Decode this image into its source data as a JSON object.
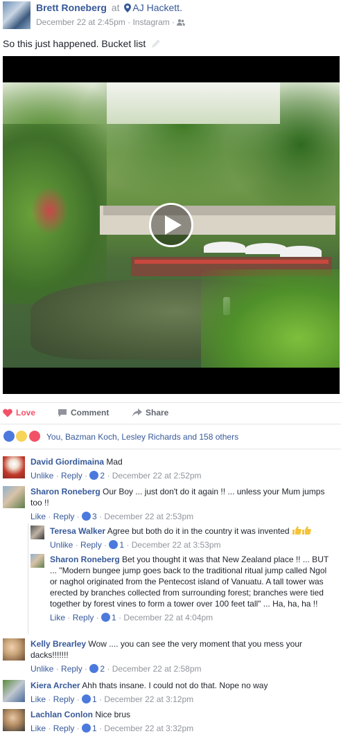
{
  "post": {
    "author": "Brett Roneberg",
    "at_word": "at",
    "place": "AJ Hackett.",
    "date": "December 22 at 2:45pm",
    "separator": "·",
    "source": "Instagram",
    "text": "So this just happened. Bucket list"
  },
  "actions": {
    "love": "Love",
    "comment": "Comment",
    "share": "Share"
  },
  "reactions": {
    "summary": "You, Bazman Koch, Lesley Richards and 158 others"
  },
  "comments": [
    {
      "name": "David Giordimaina",
      "text": "Mad",
      "action": "Unlike",
      "reply": "Reply",
      "likes": "2",
      "time": "December 22 at 2:52pm"
    },
    {
      "name": "Sharon Roneberg",
      "text": "Our Boy ... just don't do it again !! ... unless your Mum jumps too !!",
      "action": "Like",
      "reply": "Reply",
      "likes": "3",
      "time": "December 22 at 2:53pm"
    },
    {
      "name": "Teresa Walker",
      "text": "Agree but both do it in the country it was invented",
      "action": "Unlike",
      "reply": "Reply",
      "likes": "1",
      "time": "December 22 at 3:53pm"
    },
    {
      "name": "Sharon Roneberg",
      "text": "Bet you thought it was that New Zealand place !! ... BUT ... \"Modern bungee jump goes back to the traditional ritual jump called Ngol or naghol originated from the Pentecost island of Vanuatu. A tall tower was erected by branches collected from surrounding forest; branches were tied together by forest vines to form a tower over 100 feet tall\" ... Ha, ha, ha !!",
      "action": "Like",
      "reply": "Reply",
      "likes": "1",
      "time": "December 22 at 4:04pm"
    },
    {
      "name": "Kelly Brearley",
      "text": "Wow .... you can see the very moment that you mess your dacks!!!!!!!",
      "action": "Unlike",
      "reply": "Reply",
      "likes": "2",
      "time": "December 22 at 2:58pm"
    },
    {
      "name": "Kiera Archer",
      "text": "Ahh thats insane. I could not do that. Nope no way",
      "action": "Like",
      "reply": "Reply",
      "likes": "1",
      "time": "December 22 at 3:12pm"
    },
    {
      "name": "Lachlan Conlon",
      "text": "Nice brus",
      "action": "Like",
      "reply": "Reply",
      "likes": "1",
      "time": "December 22 at 3:32pm"
    }
  ],
  "colors": {
    "link": "#365899",
    "meta": "#90949c",
    "love": "#f25268",
    "like_blue": "#4b79dd"
  },
  "icons": [
    "location-pin-icon",
    "friends-audience-icon",
    "pencil-icon",
    "play-icon",
    "heart-icon",
    "comment-icon",
    "share-arrow-icon",
    "like-thumb-icon",
    "thumbs-up-emoji"
  ]
}
